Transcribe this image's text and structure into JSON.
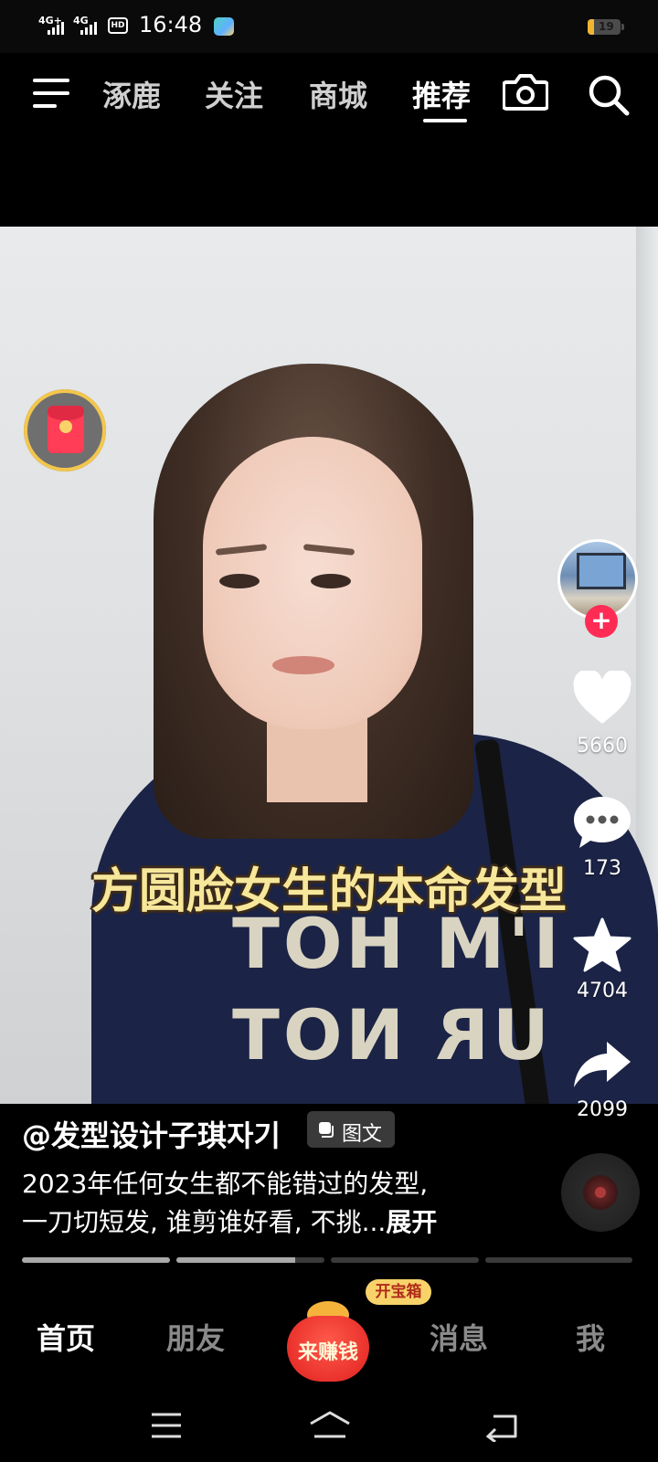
{
  "status_bar": {
    "sim1": "4G+",
    "sim2": "4G",
    "hd": "HD",
    "time": "16:48",
    "battery": "19",
    "battery_level": 0.19
  },
  "top_nav": {
    "tabs": [
      {
        "label": "涿鹿",
        "active": false
      },
      {
        "label": "关注",
        "active": false
      },
      {
        "label": "商城",
        "active": false
      },
      {
        "label": "推荐",
        "active": true
      }
    ],
    "icons": [
      "menu-icon",
      "camera-icon",
      "search-icon"
    ]
  },
  "video": {
    "caption": "方圆脸女生的本命发型",
    "shirt_text_line1": "I'M HOT",
    "shirt_text_line2": "UR NOT"
  },
  "right_rail": {
    "like_count": "5660",
    "comment_count": "173",
    "favorite_count": "4704",
    "share_count": "2099"
  },
  "post": {
    "author": "@发型设计子琪자기",
    "type_badge": "图文",
    "description_line1": "2023年任何女生都不能错过的发型,",
    "description_line2": "一刀切短发, 谁剪谁好看, 不挑...",
    "expand_label": "展开",
    "progress_segments": [
      1.0,
      0.8,
      0.0,
      0.0
    ]
  },
  "bottom_nav": {
    "items": [
      {
        "label": "首页",
        "active": true
      },
      {
        "label": "朋友",
        "active": false
      },
      {
        "label": "消息",
        "active": false
      },
      {
        "label": "我",
        "active": false
      }
    ],
    "earn_label": "来赚钱",
    "chest_badge": "开宝箱"
  },
  "colors": {
    "accent": "#fe2c55",
    "caption_yellow": "#f7e79b",
    "background": "#000000"
  }
}
